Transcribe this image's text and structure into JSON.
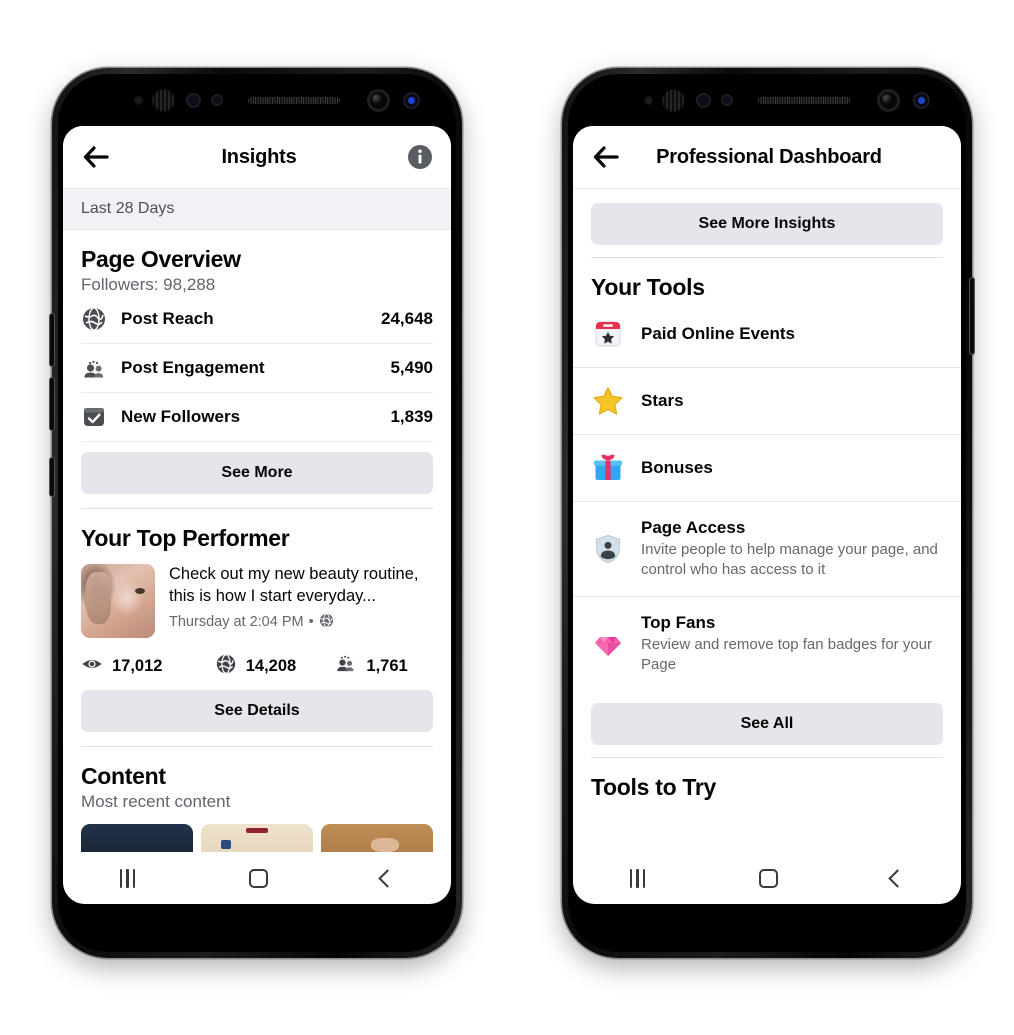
{
  "left_phone": {
    "header": {
      "title": "Insights",
      "back_icon": "back-arrow-icon",
      "info_icon": "info-icon"
    },
    "date_range": "Last 28 Days",
    "page_overview": {
      "title": "Page Overview",
      "followers_label": "Followers: 98,288",
      "metrics": [
        {
          "icon": "globe-icon",
          "label": "Post Reach",
          "value": "24,648"
        },
        {
          "icon": "people-icon",
          "label": "Post Engagement",
          "value": "5,490"
        },
        {
          "icon": "checkbox-icon",
          "label": "New Followers",
          "value": "1,839"
        }
      ],
      "see_more_label": "See More"
    },
    "top_performer": {
      "title": "Your Top Performer",
      "post_line1": "Check out my new beauty routine,",
      "post_line2": "this is how I start everyday...",
      "timestamp": "Thursday at 2:04 PM",
      "meta_separator": "•",
      "privacy_icon": "globe-icon",
      "stats": [
        {
          "icon": "eye-icon",
          "value": "17,012"
        },
        {
          "icon": "globe-icon",
          "value": "14,208"
        },
        {
          "icon": "people-icon",
          "value": "1,761"
        }
      ],
      "see_details_label": "See Details"
    },
    "content": {
      "title": "Content",
      "subtitle": "Most recent content"
    },
    "navbar": {
      "recents": "recents-icon",
      "home": "home-icon",
      "back": "back-icon"
    }
  },
  "right_phone": {
    "header": {
      "title": "Professional Dashboard",
      "back_icon": "back-arrow-icon"
    },
    "see_more_insights_label": "See More Insights",
    "your_tools": {
      "title": "Your Tools",
      "items": [
        {
          "icon": "calendar-star-icon",
          "name": "Paid Online Events",
          "desc": ""
        },
        {
          "icon": "star-icon",
          "name": "Stars",
          "desc": ""
        },
        {
          "icon": "gift-icon",
          "name": "Bonuses",
          "desc": ""
        },
        {
          "icon": "shield-person-icon",
          "name": "Page Access",
          "desc": "Invite people to help manage your page, and control who has access to it"
        },
        {
          "icon": "diamond-icon",
          "name": "Top Fans",
          "desc": "Review and remove top fan badges for your Page"
        }
      ],
      "see_all_label": "See All"
    },
    "tools_to_try": {
      "title": "Tools to Try"
    },
    "navbar": {
      "recents": "recents-icon",
      "home": "home-icon",
      "back": "back-icon"
    }
  },
  "colors": {
    "page_bg": "#ffffff",
    "gray_button": "#e4e6eb",
    "band_bg": "#f0f2f5",
    "text_primary": "#050505",
    "text_secondary": "#65686c",
    "divider": "#dcdfe3"
  }
}
